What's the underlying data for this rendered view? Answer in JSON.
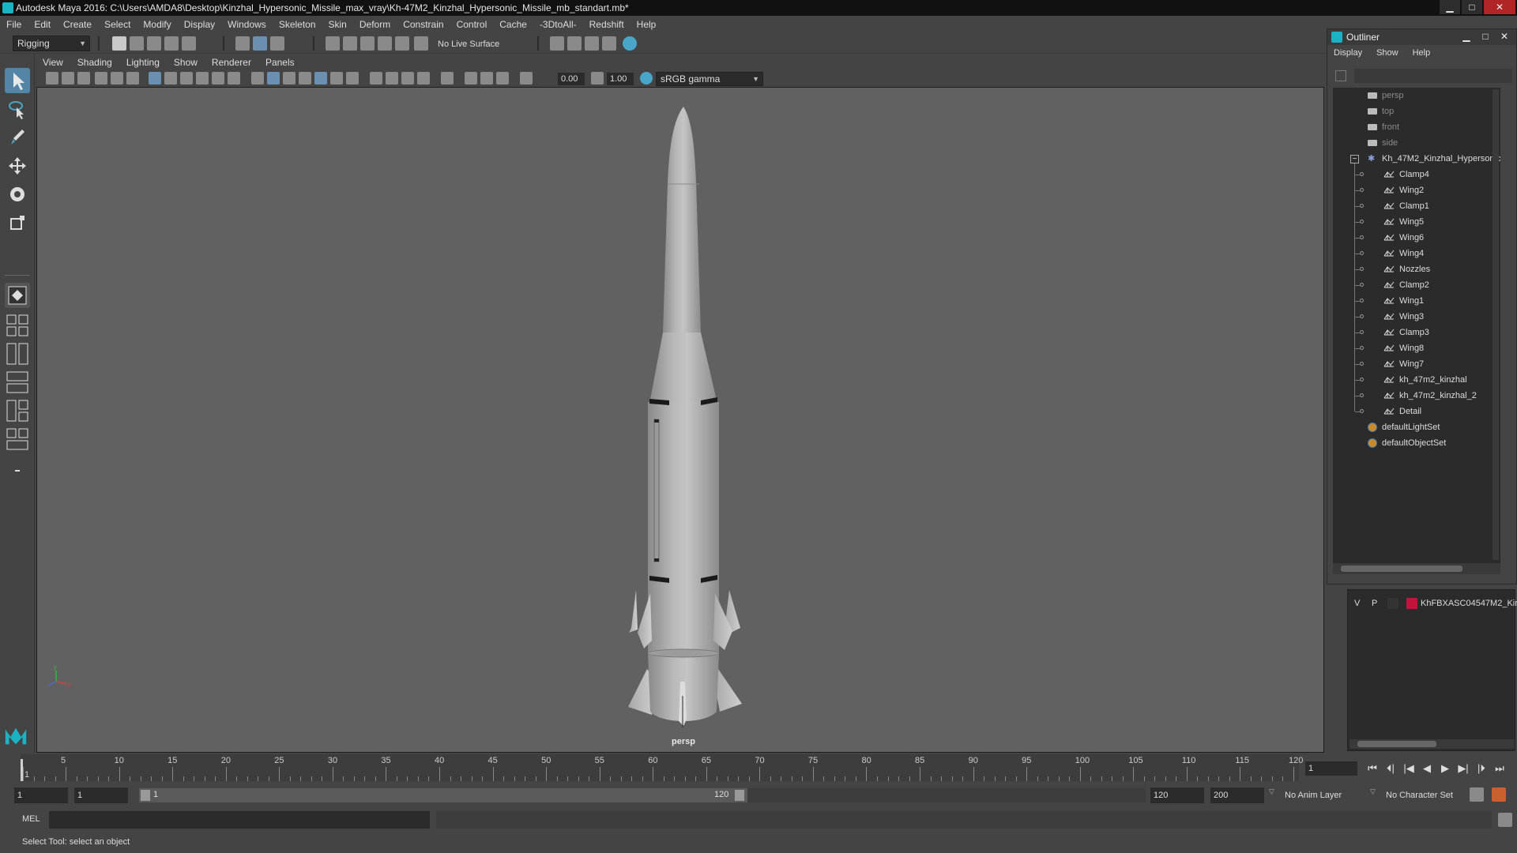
{
  "window": {
    "title": "Autodesk Maya 2016: C:\\Users\\AMDA8\\Desktop\\Kinzhal_Hypersonic_Missile_max_vray\\Kh-47M2_Kinzhal_Hypersonic_Missile_mb_standart.mb*",
    "minimize": "▁",
    "maximize": "□",
    "close": "✕"
  },
  "menubar": [
    "File",
    "Edit",
    "Create",
    "Select",
    "Modify",
    "Display",
    "Windows",
    "Skeleton",
    "Skin",
    "Deform",
    "Constrain",
    "Control",
    "Cache",
    "-3DtoAll-",
    "Redshift",
    "Help"
  ],
  "statusline": {
    "menuset": "Rigging",
    "live_surface": "No Live Surface"
  },
  "panel": {
    "menus": [
      "View",
      "Shading",
      "Lighting",
      "Show",
      "Renderer",
      "Panels"
    ],
    "exposure": "0.00",
    "gamma": "1.00",
    "color_space": "sRGB gamma"
  },
  "viewport": {
    "camera_label": "persp",
    "axis_x": "x",
    "axis_y": "y"
  },
  "outliner": {
    "title": "Outliner",
    "menus": [
      "Display",
      "Show",
      "Help"
    ],
    "cameras": [
      "persp",
      "top",
      "front",
      "side"
    ],
    "root": "Kh_47M2_Kinzhal_Hypersonic",
    "root_expand": "−",
    "children": [
      "Clamp4",
      "Wing2",
      "Clamp1",
      "Wing5",
      "Wing6",
      "Wing4",
      "Nozzles",
      "Clamp2",
      "Wing1",
      "Wing3",
      "Clamp3",
      "Wing8",
      "Wing7",
      "kh_47m2_kinzhal",
      "kh_47m2_kinzhal_2",
      "Detail"
    ],
    "sets": [
      "defaultLightSet",
      "defaultObjectSet"
    ]
  },
  "layer": {
    "v": "V",
    "p": "P",
    "name": "KhFBXASC04547M2_Kin",
    "color": "#c0143c"
  },
  "timeline": {
    "ticks": [
      "1",
      "5",
      "10",
      "15",
      "20",
      "25",
      "30",
      "35",
      "40",
      "45",
      "50",
      "55",
      "60",
      "65",
      "70",
      "75",
      "80",
      "85",
      "90",
      "95",
      "100",
      "105",
      "110",
      "115",
      "120"
    ],
    "current_frame": "1"
  },
  "playback": [
    "⏮",
    "⏴|",
    "|◀",
    "◀",
    "▶",
    "▶|",
    "|⏵",
    "⏭"
  ],
  "range": {
    "start": "1",
    "anim_start": "1",
    "slider_start": "1",
    "slider_end": "120",
    "end": "120",
    "anim_end": "200",
    "anim_layer": "No Anim Layer",
    "character_set": "No Character Set"
  },
  "cmdline": {
    "label": "MEL"
  },
  "helpline": "Select Tool: select an object",
  "colors": {
    "accent": "#5285a6",
    "maya_teal": "#1bb3c4"
  }
}
